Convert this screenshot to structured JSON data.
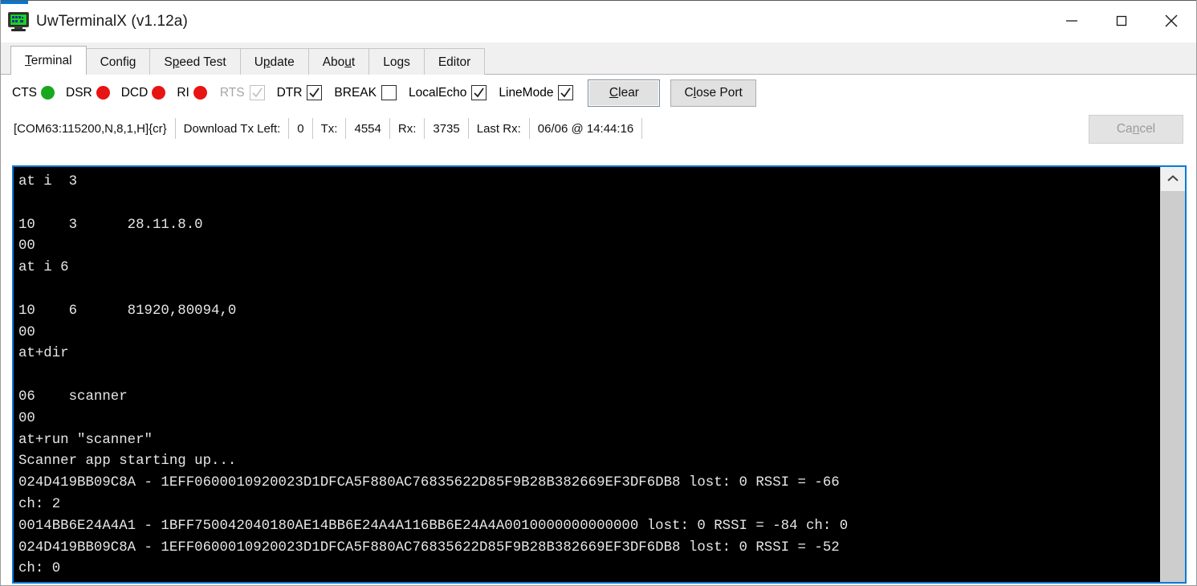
{
  "window": {
    "title": "UwTerminalX (v1.12a)",
    "icon": "monitor-icon",
    "minimize_label": "—",
    "maximize_label": "□",
    "close_label": "✕",
    "accent_color": "#0078d7"
  },
  "tabs": [
    {
      "label": "Terminal",
      "mnemonic": "T",
      "active": true
    },
    {
      "label": "Config",
      "mnemonic": "g",
      "active": false
    },
    {
      "label": "Speed Test",
      "mnemonic": "p",
      "active": false
    },
    {
      "label": "Update",
      "mnemonic": "p",
      "active": false
    },
    {
      "label": "About",
      "mnemonic": "u",
      "active": false
    },
    {
      "label": "Logs",
      "mnemonic": "g",
      "active": false
    },
    {
      "label": "Editor",
      "mnemonic": "",
      "active": false
    }
  ],
  "controls": {
    "signals": [
      {
        "label": "CTS",
        "state": "on",
        "color": "#18a81c"
      },
      {
        "label": "DSR",
        "state": "off",
        "color": "#e81414"
      },
      {
        "label": "DCD",
        "state": "off",
        "color": "#e81414"
      },
      {
        "label": "RI",
        "state": "off",
        "color": "#e81414"
      }
    ],
    "checkboxes": [
      {
        "label": "RTS",
        "checked": true,
        "enabled": false
      },
      {
        "label": "DTR",
        "checked": true,
        "enabled": true
      },
      {
        "label": "BREAK",
        "checked": false,
        "enabled": true
      },
      {
        "label": "LocalEcho",
        "checked": true,
        "enabled": true
      },
      {
        "label": "LineMode",
        "checked": true,
        "enabled": true
      }
    ],
    "clear_button": "Clear",
    "clear_mnemonic": "C",
    "close_port_button": "Close Port",
    "close_port_mnemonic": "l"
  },
  "status": {
    "port_string": "[COM63:115200,N,8,1,H]{cr}",
    "download_tx_left_label": "Download Tx Left:",
    "download_tx_left_value": "0",
    "tx_label": "Tx:",
    "tx_value": "4554",
    "rx_label": "Rx:",
    "rx_value": "3735",
    "last_rx_label": "Last Rx:",
    "last_rx_value": "06/06 @ 14:44:16",
    "cancel_button": "Cancel",
    "cancel_mnemonic": "n",
    "cancel_enabled": false
  },
  "terminal": {
    "foreground": "#e6e6e6",
    "background": "#000000",
    "border_color": "#0a7ad6",
    "lines": [
      "at i  3",
      "",
      "10    3      28.11.8.0",
      "00",
      "at i 6",
      "",
      "10    6      81920,80094,0",
      "00",
      "at+dir",
      "",
      "06    scanner",
      "00",
      "at+run \"scanner\"",
      "Scanner app starting up...",
      "024D419BB09C8A - 1EFF0600010920023D1DFCA5F880AC76835622D85F9B28B382669EF3DF6DB8 lost: 0 RSSI = -66",
      "ch: 2",
      "0014BB6E24A4A1 - 1BFF750042040180AE14BB6E24A4A116BB6E24A4A0010000000000000 lost: 0 RSSI = -84 ch: 0",
      "024D419BB09C8A - 1EFF0600010920023D1DFCA5F880AC76835622D85F9B28B382669EF3DF6DB8 lost: 0 RSSI = -52",
      "ch: 0"
    ]
  },
  "scrollbar": {
    "up_arrow": "scroll-up-arrow"
  }
}
